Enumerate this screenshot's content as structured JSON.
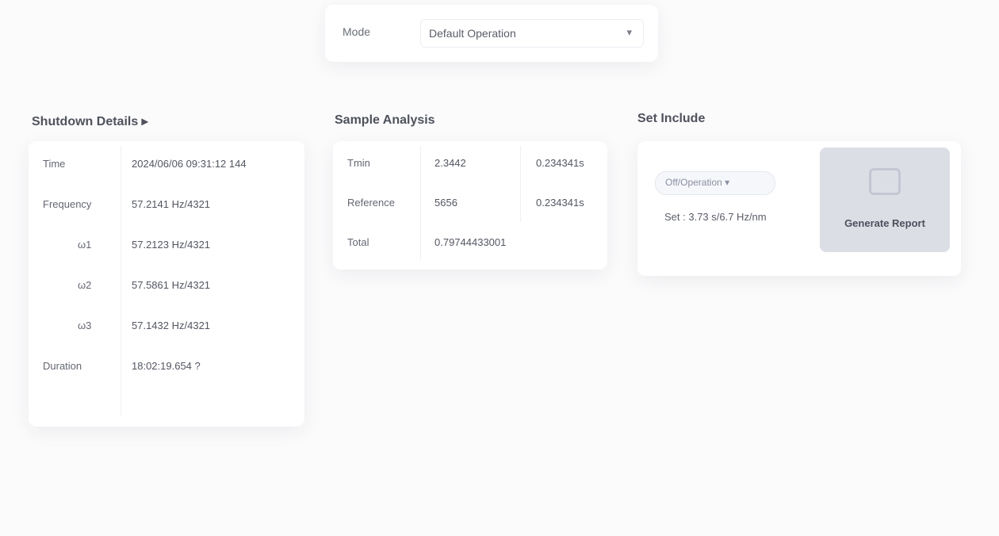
{
  "top_bar": {
    "label": "Mode",
    "select_value": "Default Operation",
    "caret": "▾"
  },
  "left_panel": {
    "title": "Shutdown Details ▸",
    "rows": [
      {
        "key": "Time",
        "value": "2024/06/06 09:31:12 144"
      },
      {
        "key": "Frequency",
        "value": "57.2141 Hz/4321"
      },
      {
        "key": "ω1",
        "value": "57.2123 Hz/4321"
      },
      {
        "key": "ω2",
        "value": "57.5861 Hz/4321"
      },
      {
        "key": "ω3",
        "value": "57.1432 Hz/4321"
      },
      {
        "key": "Duration",
        "value": "18:02:19.654 ?"
      }
    ]
  },
  "middle_panel": {
    "title": "Sample Analysis",
    "rows": [
      {
        "c1": "Tmin",
        "c2": "2.3442",
        "c3": "0.234341s"
      },
      {
        "c1": "Reference",
        "c2": "5656",
        "c3": "0.234341s"
      },
      {
        "c1": "Total",
        "c2": "0.79744433001",
        "c3": ""
      }
    ]
  },
  "right_panel": {
    "title": "Set Include",
    "chip": "Off/Operation ▾",
    "desc": "Set : 3.73 s/6.7 Hz/nm",
    "button_label": "Generate Report"
  }
}
